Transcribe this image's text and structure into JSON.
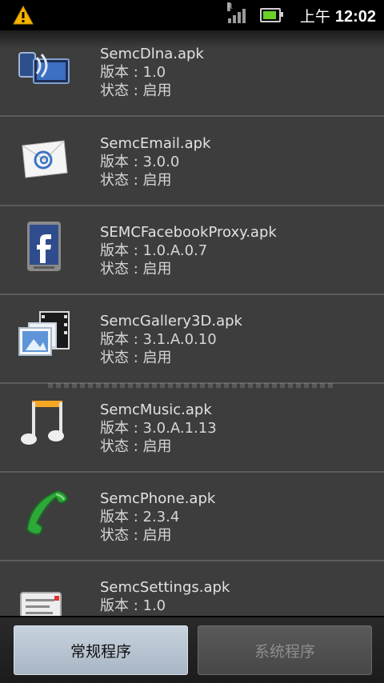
{
  "status_bar": {
    "ampm": "上午",
    "time": "12:02",
    "signal_label": "R"
  },
  "apps": [
    {
      "name": "SemcDlna.apk",
      "version": "版本 : 1.0",
      "status": "状态 : 启用",
      "icon": "dlna-icon"
    },
    {
      "name": "SemcEmail.apk",
      "version": "版本 : 3.0.0",
      "status": "状态 : 启用",
      "icon": "email-icon"
    },
    {
      "name": "SEMCFacebookProxy.apk",
      "version": "版本 : 1.0.A.0.7",
      "status": "状态 : 启用",
      "icon": "facebook-icon"
    },
    {
      "name": "SemcGallery3D.apk",
      "version": "版本 : 3.1.A.0.10",
      "status": "状态 : 启用",
      "icon": "gallery-icon"
    },
    {
      "name": "SemcMusic.apk",
      "version": "版本 : 3.0.A.1.13",
      "status": "状态 : 启用",
      "icon": "music-icon"
    },
    {
      "name": "SemcPhone.apk",
      "version": "版本 : 2.3.4",
      "status": "状态 : 启用",
      "icon": "phone-icon"
    },
    {
      "name": "SemcSettings.apk",
      "version": "版本 : 1.0",
      "status": "",
      "icon": "settings-icon"
    }
  ],
  "tabs": {
    "regular": "常规程序",
    "system": "系统程序"
  },
  "colors": {
    "active_tab": "#b8c4d0",
    "inactive_tab": "#505050",
    "battery": "#6ad12a",
    "warning": "#f5b400"
  }
}
